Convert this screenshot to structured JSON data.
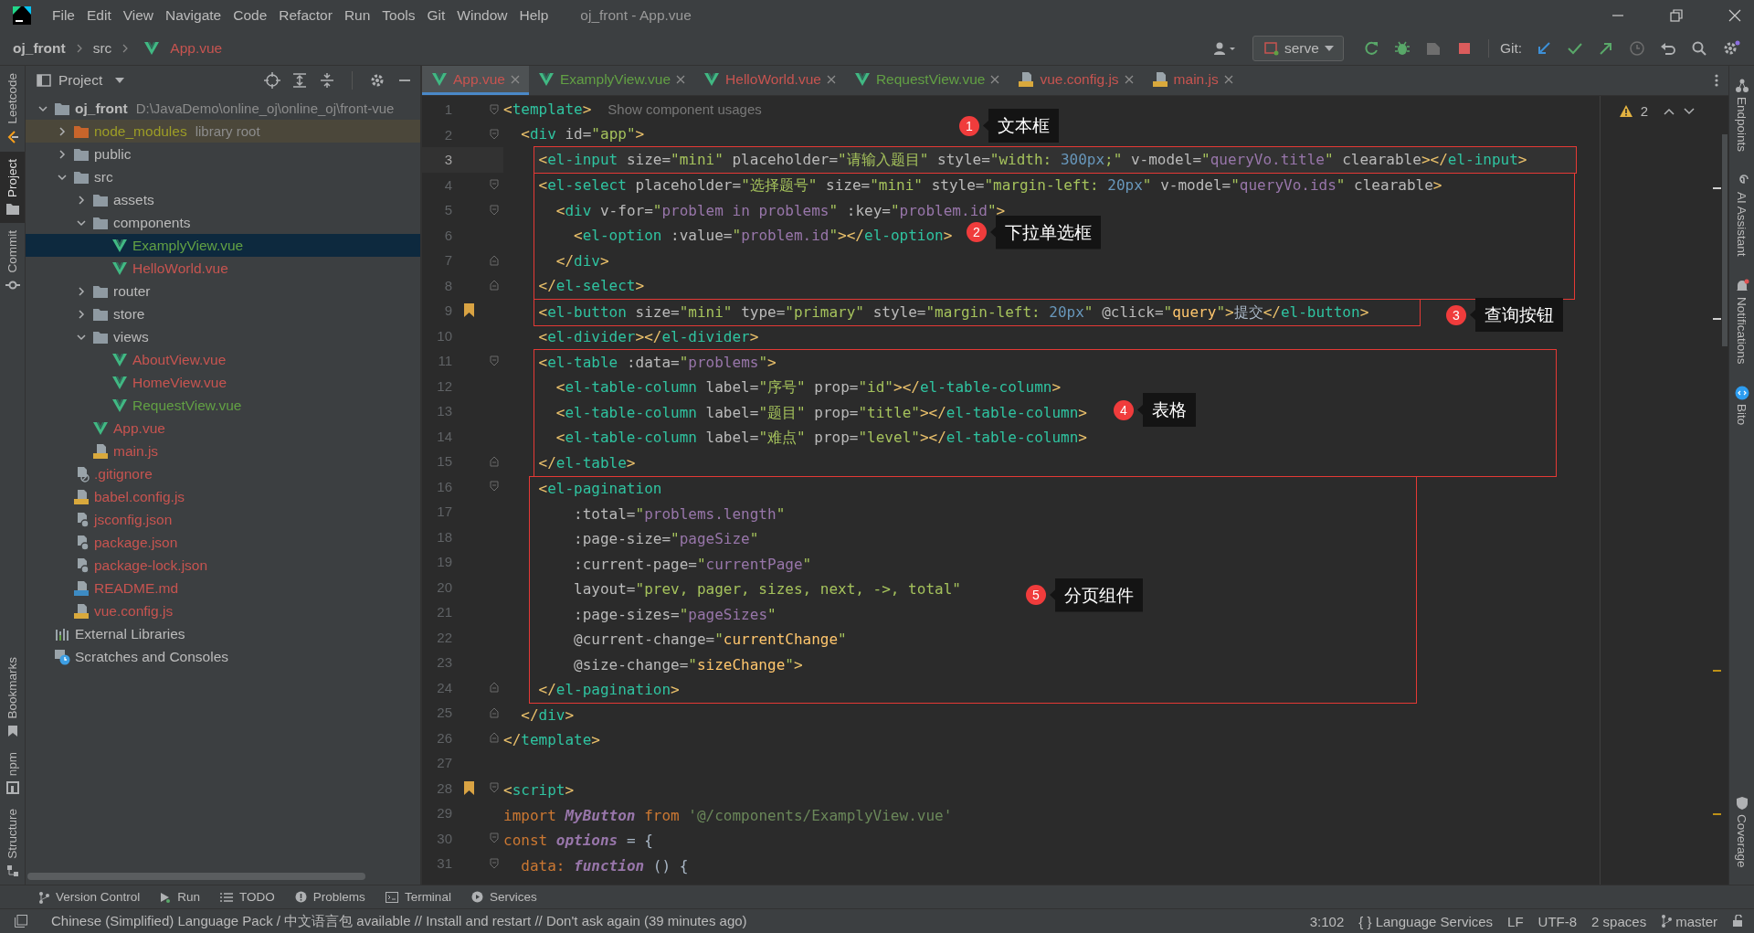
{
  "window": {
    "title": "oj_front - App.vue"
  },
  "menu": [
    "File",
    "Edit",
    "View",
    "Navigate",
    "Code",
    "Refactor",
    "Run",
    "Tools",
    "Git",
    "Window",
    "Help"
  ],
  "breadcrumb": [
    {
      "label": "oj_front",
      "kind": "project"
    },
    {
      "label": "src",
      "kind": "folder"
    },
    {
      "label": "App.vue",
      "kind": "vue"
    }
  ],
  "toolbar": {
    "run_config": "serve",
    "git_label": "Git:"
  },
  "left_stripe": {
    "top": [
      {
        "label": "Leetcode",
        "selected": false
      },
      {
        "label": "Project",
        "selected": true
      },
      {
        "label": "Commit",
        "selected": false
      }
    ],
    "bottom": [
      {
        "label": "Bookmarks",
        "selected": false
      },
      {
        "label": "npm",
        "selected": false
      },
      {
        "label": "Structure",
        "selected": false
      }
    ]
  },
  "project_panel": {
    "title": "Project",
    "tree": [
      {
        "name": "oj_front",
        "hint": "D:\\JavaDemo\\online_oj\\online_oj\\front-vue",
        "kind": "root",
        "color": "#bbbbbb",
        "selected": false,
        "expanded": true,
        "children": [
          {
            "name": "node_modules",
            "hint": "library root",
            "kind": "library-folder",
            "color": "#9d9d26",
            "selected": false,
            "expanded": false
          },
          {
            "name": "public",
            "kind": "folder",
            "color": "#bbbbbb",
            "selected": false,
            "expanded": false
          },
          {
            "name": "src",
            "kind": "folder",
            "color": "#bbbbbb",
            "selected": false,
            "expanded": true,
            "children": [
              {
                "name": "assets",
                "kind": "folder",
                "color": "#bbbbbb",
                "selected": false,
                "expanded": false
              },
              {
                "name": "components",
                "kind": "folder",
                "color": "#bbbbbb",
                "selected": false,
                "expanded": true,
                "children": [
                  {
                    "name": "ExamplyView.vue",
                    "kind": "vue",
                    "color": "#62a044",
                    "selected": true
                  },
                  {
                    "name": "HelloWorld.vue",
                    "kind": "vue",
                    "color": "#c75450",
                    "selected": false
                  }
                ]
              },
              {
                "name": "router",
                "kind": "folder",
                "color": "#bbbbbb",
                "selected": false,
                "expanded": false
              },
              {
                "name": "store",
                "kind": "folder",
                "color": "#bbbbbb",
                "selected": false,
                "expanded": false
              },
              {
                "name": "views",
                "kind": "folder",
                "color": "#bbbbbb",
                "selected": false,
                "expanded": true,
                "children": [
                  {
                    "name": "AboutView.vue",
                    "kind": "vue",
                    "color": "#c75450",
                    "selected": false
                  },
                  {
                    "name": "HomeView.vue",
                    "kind": "vue",
                    "color": "#c75450",
                    "selected": false
                  },
                  {
                    "name": "RequestView.vue",
                    "kind": "vue",
                    "color": "#62a044",
                    "selected": false
                  }
                ]
              },
              {
                "name": "App.vue",
                "kind": "vue",
                "color": "#c75450",
                "selected": false
              },
              {
                "name": "main.js",
                "kind": "js",
                "color": "#c75450",
                "selected": false
              }
            ]
          },
          {
            "name": ".gitignore",
            "kind": "gitignore",
            "color": "#c75450",
            "selected": false
          },
          {
            "name": "babel.config.js",
            "kind": "js",
            "color": "#c75450",
            "selected": false
          },
          {
            "name": "jsconfig.json",
            "kind": "json",
            "color": "#c75450",
            "selected": false
          },
          {
            "name": "package.json",
            "kind": "json",
            "color": "#c75450",
            "selected": false
          },
          {
            "name": "package-lock.json",
            "kind": "json",
            "color": "#c75450",
            "selected": false
          },
          {
            "name": "README.md",
            "kind": "md",
            "color": "#c75450",
            "selected": false
          },
          {
            "name": "vue.config.js",
            "kind": "js",
            "color": "#c75450",
            "selected": false
          }
        ]
      },
      {
        "name": "External Libraries",
        "kind": "libs",
        "color": "#bbbbbb",
        "selected": false
      },
      {
        "name": "Scratches and Consoles",
        "kind": "scratch",
        "color": "#bbbbbb",
        "selected": false
      }
    ]
  },
  "editor": {
    "tabs": [
      {
        "label": "App.vue",
        "kind": "vue",
        "color": "#c75450",
        "selected": true
      },
      {
        "label": "ExamplyView.vue",
        "kind": "vue",
        "color": "#62a044",
        "selected": false
      },
      {
        "label": "HelloWorld.vue",
        "kind": "vue",
        "color": "#c75450",
        "selected": false
      },
      {
        "label": "RequestView.vue",
        "kind": "vue",
        "color": "#62a044",
        "selected": false
      },
      {
        "label": "vue.config.js",
        "kind": "js",
        "color": "#c75450",
        "selected": false
      },
      {
        "label": "main.js",
        "kind": "js",
        "color": "#c75450",
        "selected": false
      }
    ],
    "warnings": "2",
    "blocks": [
      {
        "kind": "plain",
        "lines": [
          {
            "number": "1",
            "kind": "fold-start",
            "current": false,
            "bookmarked": false,
            "code": "<template>",
            "hint": "Show component usages"
          },
          {
            "number": "2",
            "kind": "fold-start",
            "current": false,
            "bookmarked": false,
            "code": "  <div id=\"app\">"
          }
        ]
      },
      {
        "kind": "annotated",
        "number": "1",
        "label": "文本框",
        "lines": [
          {
            "number": "3",
            "kind": "plain",
            "current": true,
            "bookmarked": false,
            "code": "    <el-input size=\"mini\" placeholder=\"请输入题目\" style=\"width: 300px;\" v-model=\"queryVo.title\" clearable></el-input>"
          }
        ]
      },
      {
        "kind": "annotated",
        "number": "2",
        "label": "下拉单选框",
        "lines": [
          {
            "number": "4",
            "kind": "fold-start",
            "current": false,
            "bookmarked": false,
            "code": "    <el-select placeholder=\"选择题号\" size=\"mini\" style=\"margin-left: 20px\" v-model=\"queryVo.ids\" clearable>"
          },
          {
            "number": "5",
            "kind": "fold-start",
            "current": false,
            "bookmarked": false,
            "code": "      <div v-for=\"problem in problems\" :key=\"problem.id\">"
          },
          {
            "number": "6",
            "kind": "plain",
            "current": false,
            "bookmarked": false,
            "code": "        <el-option :value=\"problem.id\"></el-option>"
          },
          {
            "number": "7",
            "kind": "fold-end",
            "current": false,
            "bookmarked": false,
            "code": "      </div>"
          },
          {
            "number": "8",
            "kind": "fold-end",
            "current": false,
            "bookmarked": false,
            "code": "    </el-select>"
          }
        ]
      },
      {
        "kind": "annotated",
        "number": "3",
        "label": "查询按钮",
        "lines": [
          {
            "number": "9",
            "kind": "plain",
            "current": false,
            "bookmarked": true,
            "code": "    <el-button size=\"mini\" type=\"primary\" style=\"margin-left: 20px\" @click=\"query\">提交</el-button>"
          }
        ]
      },
      {
        "kind": "plain",
        "lines": [
          {
            "number": "10",
            "kind": "plain",
            "current": false,
            "bookmarked": false,
            "code": "    <el-divider></el-divider>"
          }
        ]
      },
      {
        "kind": "annotated",
        "number": "4",
        "label": "表格",
        "lines": [
          {
            "number": "11",
            "kind": "fold-start",
            "current": false,
            "bookmarked": false,
            "code": "    <el-table :data=\"problems\">"
          },
          {
            "number": "12",
            "kind": "plain",
            "current": false,
            "bookmarked": false,
            "code": "      <el-table-column label=\"序号\" prop=\"id\"></el-table-column>"
          },
          {
            "number": "13",
            "kind": "plain",
            "current": false,
            "bookmarked": false,
            "code": "      <el-table-column label=\"题目\" prop=\"title\"></el-table-column>"
          },
          {
            "number": "14",
            "kind": "plain",
            "current": false,
            "bookmarked": false,
            "code": "      <el-table-column label=\"难点\" prop=\"level\"></el-table-column>"
          },
          {
            "number": "15",
            "kind": "fold-end",
            "current": false,
            "bookmarked": false,
            "code": "    </el-table>"
          }
        ]
      },
      {
        "kind": "annotated",
        "number": "5",
        "label": "分页组件",
        "lines": [
          {
            "number": "16",
            "kind": "fold-start",
            "current": false,
            "bookmarked": false,
            "code": "    <el-pagination"
          },
          {
            "number": "17",
            "kind": "plain",
            "current": false,
            "bookmarked": false,
            "code": "        :total=\"problems.length\""
          },
          {
            "number": "18",
            "kind": "plain",
            "current": false,
            "bookmarked": false,
            "code": "        :page-size=\"pageSize\""
          },
          {
            "number": "19",
            "kind": "plain",
            "current": false,
            "bookmarked": false,
            "code": "        :current-page=\"currentPage\""
          },
          {
            "number": "20",
            "kind": "plain",
            "current": false,
            "bookmarked": false,
            "code": "        layout=\"prev, pager, sizes, next, ->, total\""
          },
          {
            "number": "21",
            "kind": "plain",
            "current": false,
            "bookmarked": false,
            "code": "        :page-sizes=\"pageSizes\""
          },
          {
            "number": "22",
            "kind": "plain",
            "current": false,
            "bookmarked": false,
            "code": "        @current-change=\"currentChange\""
          },
          {
            "number": "23",
            "kind": "plain",
            "current": false,
            "bookmarked": false,
            "code": "        @size-change=\"sizeChange\">"
          },
          {
            "number": "24",
            "kind": "fold-end",
            "current": false,
            "bookmarked": false,
            "code": "    </el-pagination>"
          }
        ]
      },
      {
        "kind": "plain",
        "lines": [
          {
            "number": "25",
            "kind": "fold-end",
            "current": false,
            "bookmarked": false,
            "code": "  </div>"
          },
          {
            "number": "26",
            "kind": "fold-end",
            "current": false,
            "bookmarked": false,
            "code": "</template>"
          },
          {
            "number": "27",
            "kind": "plain",
            "current": false,
            "bookmarked": false
          },
          {
            "number": "28",
            "kind": "fold-start",
            "current": false,
            "bookmarked": true,
            "code": "<script>"
          },
          {
            "number": "29",
            "kind": "plain",
            "current": false,
            "bookmarked": false,
            "code": "import MyButton from '@/components/ExamplyView.vue'"
          },
          {
            "number": "30",
            "kind": "fold-start",
            "current": false,
            "bookmarked": false,
            "code": "const options = {"
          },
          {
            "number": "31",
            "kind": "fold-start",
            "current": false,
            "bookmarked": false,
            "code": "  data: function () {"
          }
        ]
      }
    ]
  },
  "right_stripe": [
    {
      "label": "Endpoints",
      "selected": false
    },
    {
      "label": "AI Assistant",
      "selected": false
    },
    {
      "label": "Notifications",
      "selected": false
    },
    {
      "label": "Bito",
      "selected": false
    },
    {
      "label": "Coverage",
      "selected": false
    }
  ],
  "tool_windows": [
    "Version Control",
    "Run",
    "TODO",
    "Problems",
    "Terminal",
    "Services"
  ],
  "status_bar": {
    "message": "Chinese (Simplified) Language Pack / 中文语言包 available // Install and restart // Don't ask again (39 minutes ago)",
    "position": "3:102",
    "language_services": "{ } Language Services",
    "line_ending": "LF",
    "encoding": "UTF-8",
    "indent": "2 spaces",
    "branch": "master"
  }
}
